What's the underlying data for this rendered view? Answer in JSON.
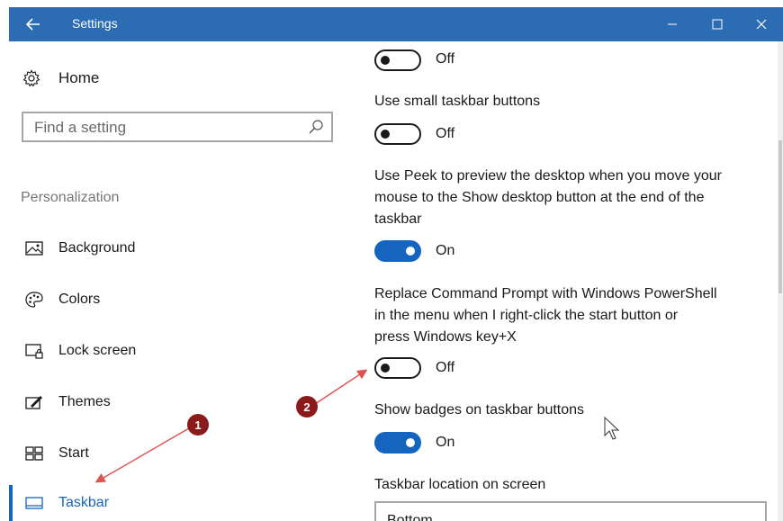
{
  "window": {
    "title": "Settings",
    "accent_color": "#2b6cb3",
    "controls": [
      "minimize",
      "maximize",
      "close"
    ]
  },
  "sidebar": {
    "home_label": "Home",
    "search_placeholder": "Find a setting",
    "section_title": "Personalization",
    "items": [
      {
        "label": "Background",
        "icon": "picture-icon"
      },
      {
        "label": "Colors",
        "icon": "palette-icon"
      },
      {
        "label": "Lock screen",
        "icon": "lock-screen-icon"
      },
      {
        "label": "Themes",
        "icon": "themes-icon"
      },
      {
        "label": "Start",
        "icon": "start-icon"
      },
      {
        "label": "Taskbar",
        "icon": "taskbar-icon",
        "active": true
      }
    ]
  },
  "content": {
    "settings": [
      {
        "label": "",
        "state": "Off"
      },
      {
        "label": "Use small taskbar buttons",
        "state": "Off"
      },
      {
        "label_lines": [
          "Use Peek to preview the desktop when you move your",
          "mouse to the Show desktop button at the end of the",
          "taskbar"
        ],
        "state": "On"
      },
      {
        "label_lines": [
          "Replace Command Prompt with Windows PowerShell",
          "in the menu when I right-click the start button or",
          "press Windows key+X"
        ],
        "state": "Off"
      },
      {
        "label": "Show badges on taskbar buttons",
        "state": "On"
      }
    ],
    "location_label": "Taskbar location on screen",
    "location_value": "Bottom"
  },
  "annotations": [
    {
      "number": "1"
    },
    {
      "number": "2"
    }
  ],
  "colors": {
    "toggle_on": "#1565c0",
    "annotation": "#8b1a1a"
  }
}
